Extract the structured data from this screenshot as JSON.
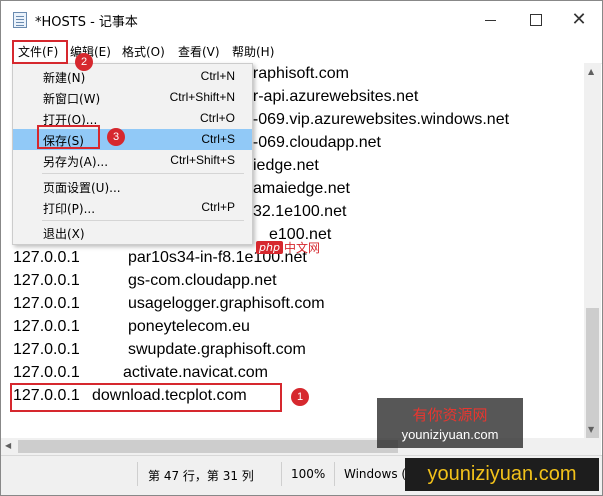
{
  "window": {
    "title": "*HOSTS - 记事本"
  },
  "menubar": {
    "file": "文件(F)",
    "edit": "编辑(E)",
    "format": "格式(O)",
    "view": "查看(V)",
    "help": "帮助(H)"
  },
  "file_menu": {
    "items": [
      {
        "label": "新建(N)",
        "shortcut": "Ctrl+N"
      },
      {
        "label": "新窗口(W)",
        "shortcut": "Ctrl+Shift+N"
      },
      {
        "label": "打开(O)...",
        "shortcut": "Ctrl+O"
      },
      {
        "label": "保存(S)",
        "shortcut": "Ctrl+S"
      },
      {
        "label": "另存为(A)...",
        "shortcut": "Ctrl+Shift+S"
      },
      {
        "label": "页面设置(U)...",
        "shortcut": ""
      },
      {
        "label": "打印(P)...",
        "shortcut": "Ctrl+P"
      },
      {
        "label": "退出(X)",
        "shortcut": ""
      }
    ],
    "highlighted": "保存(S)"
  },
  "editor": {
    "lines": [
      {
        "ip": "",
        "host": "graphisoft.com"
      },
      {
        "ip": "",
        "host": "er-api.azurewebsites.net"
      },
      {
        "ip": "",
        "host": "2-069.vip.azurewebsites.windows.net"
      },
      {
        "ip": "",
        "host": "2-069.cloudapp.net"
      },
      {
        "ip": "",
        "host": "iedge.net"
      },
      {
        "ip": "",
        "host": "amaiedge.net"
      },
      {
        "ip": "",
        "host": "32.1e100.net"
      },
      {
        "ip": "",
        "host": "e100.net"
      },
      {
        "ip": "127.0.0.1",
        "host": "par10s34-in-f8.1e100.net"
      },
      {
        "ip": "127.0.0.1",
        "host": "gs-com.cloudapp.net"
      },
      {
        "ip": "127.0.0.1",
        "host": "usagelogger.graphisoft.com"
      },
      {
        "ip": "127.0.0.1",
        "host": "poneytelecom.eu"
      },
      {
        "ip": "127.0.0.1",
        "host": "swupdate.graphisoft.com"
      },
      {
        "ip": "127.0.0.1",
        "host": "activate.navicat.com"
      },
      {
        "ip": "127.0.0.1",
        "host": "download.tecplot.com"
      }
    ]
  },
  "statusbar": {
    "position": "第 47 行，第 31 列",
    "zoom": "100%",
    "encoding": "Windows ("
  },
  "annotations": {
    "step1": "1",
    "step2": "2",
    "step3": "3"
  },
  "watermarks": {
    "php_logo": "php",
    "php_text": "中文网",
    "site_cn": "有你资源网",
    "site_en": "youniziyuan.com",
    "site_bar": "youniziyuan.com"
  },
  "colors": {
    "highlight": "#91c9f7",
    "annotation_red": "#d6282e"
  }
}
